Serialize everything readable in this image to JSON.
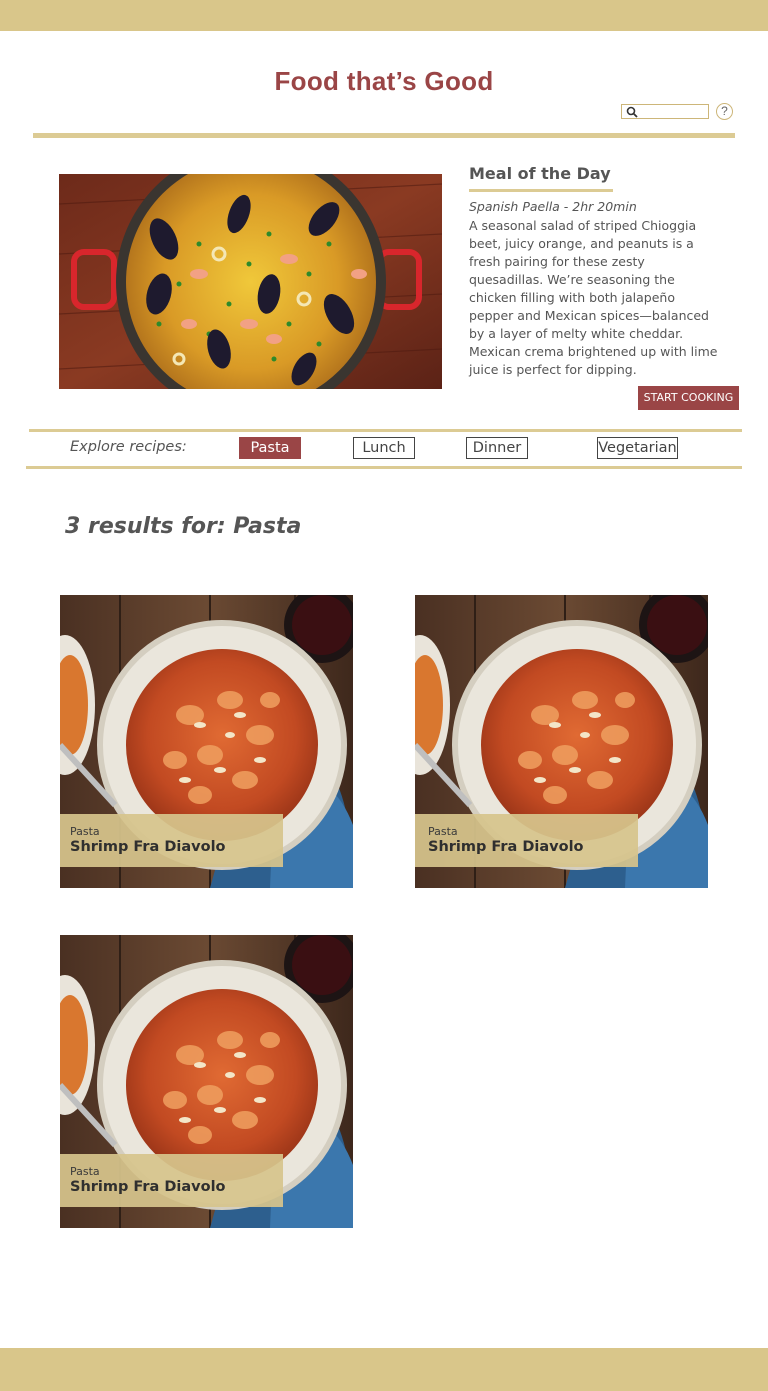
{
  "site": {
    "title": "Food that’s Good"
  },
  "search": {
    "placeholder": "",
    "icon": "search-icon",
    "help_icon": "help-icon",
    "help_text": "?"
  },
  "meal_of_the_day": {
    "heading": "Meal of the Day",
    "subtitle": "Spanish Paella - 2hr 20min",
    "description": "A seasonal salad of striped Chioggia beet, juicy orange, and peanuts is a fresh pairing for these zesty quesadillas. We’re seasoning the chicken filling with both jalapeño pepper and Mexican spices—balanced by a layer of melty white cheddar. Mexican crema brightened up with lime juice is perfect for dipping.",
    "button_label": "START COOKING"
  },
  "explore": {
    "label": "Explore recipes:",
    "categories": [
      {
        "label": "Pasta",
        "active": true
      },
      {
        "label": "Lunch",
        "active": false
      },
      {
        "label": "Dinner",
        "active": false
      },
      {
        "label": "Vegetarian",
        "active": false
      }
    ]
  },
  "results": {
    "heading": "3 results for: Pasta",
    "items": [
      {
        "category": "Pasta",
        "title": "Shrimp Fra Diavolo"
      },
      {
        "category": "Pasta",
        "title": "Shrimp Fra Diavolo"
      },
      {
        "category": "Pasta",
        "title": "Shrimp Fra Diavolo"
      }
    ]
  },
  "colors": {
    "accent": "#9a4546",
    "gold": "#d9c68a",
    "text": "#555555"
  }
}
